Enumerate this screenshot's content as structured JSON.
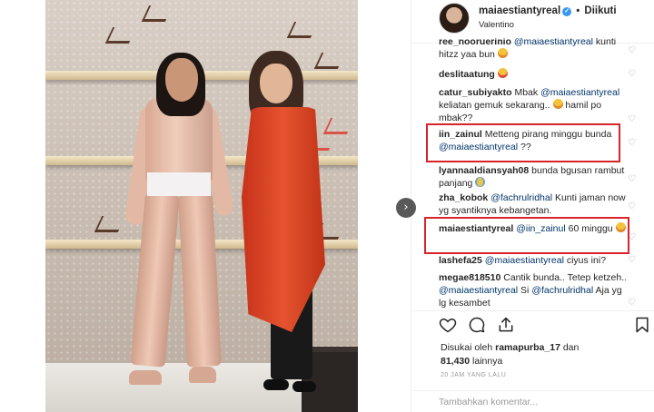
{
  "photo": {
    "next_glyph": "›"
  },
  "header": {
    "username": "maiaestiantyreal",
    "verified_glyph": "✓",
    "dot": "•",
    "follow_label": "Diikuti",
    "location": "Valentino"
  },
  "comments": [
    {
      "user": "ree_nooruerinio",
      "mention": "@maiaestiantyreal",
      "text": "kunti hitzz yaa bun",
      "emoji": "laugh",
      "partial": true
    },
    {
      "user": "deslitaatung",
      "text": "",
      "emoji": "love"
    },
    {
      "user": "catur_subiyakto",
      "text": "Mbak",
      "mention": "@maiaestiantyreal",
      "text2": "keliatan gemuk sekarang..",
      "emoji": "laugh",
      "text3": "hamil po mbak??"
    },
    {
      "user": "iin_zainul",
      "text": "Metteng pirang minggu bunda",
      "mention": "@maiaestiantyreal",
      "text2": "??"
    },
    {
      "user": "lyannaaldiansyah08",
      "text": "bunda bgusan rambut panjang",
      "emoji": "cry"
    },
    {
      "user": "zha_kobok",
      "mention": "@fachrulridhal",
      "text": "Kunti jaman now yg syantiknya kebangetan."
    },
    {
      "user": "maiaestiantyreal",
      "mention": "@iin_zainul",
      "text": "60 minggu",
      "emoji": "laugh"
    },
    {
      "user": "lashefa25",
      "mention": "@maiaestiantyreal",
      "text": "ciyus ini?"
    },
    {
      "user": "megae818510",
      "text": "Cantik bunda.. Tetep ketzeh..",
      "mention": "@maiaestiantyreal",
      "text2": "Si",
      "mention2": "@fachrulridhal",
      "text3": "Aja yg lg kesambet"
    }
  ],
  "likes": {
    "prefix": "Disukai oleh",
    "user": "ramapurba_17",
    "and": "dan",
    "count": "81,430",
    "suffix": "lainnya"
  },
  "timestamp": "20 JAM YANG LALU",
  "add_comment": {
    "placeholder": "Tambahkan komentar..."
  },
  "colors": {
    "highlight": "#d8232a",
    "verified": "#3897f0",
    "mention": "#003569"
  }
}
